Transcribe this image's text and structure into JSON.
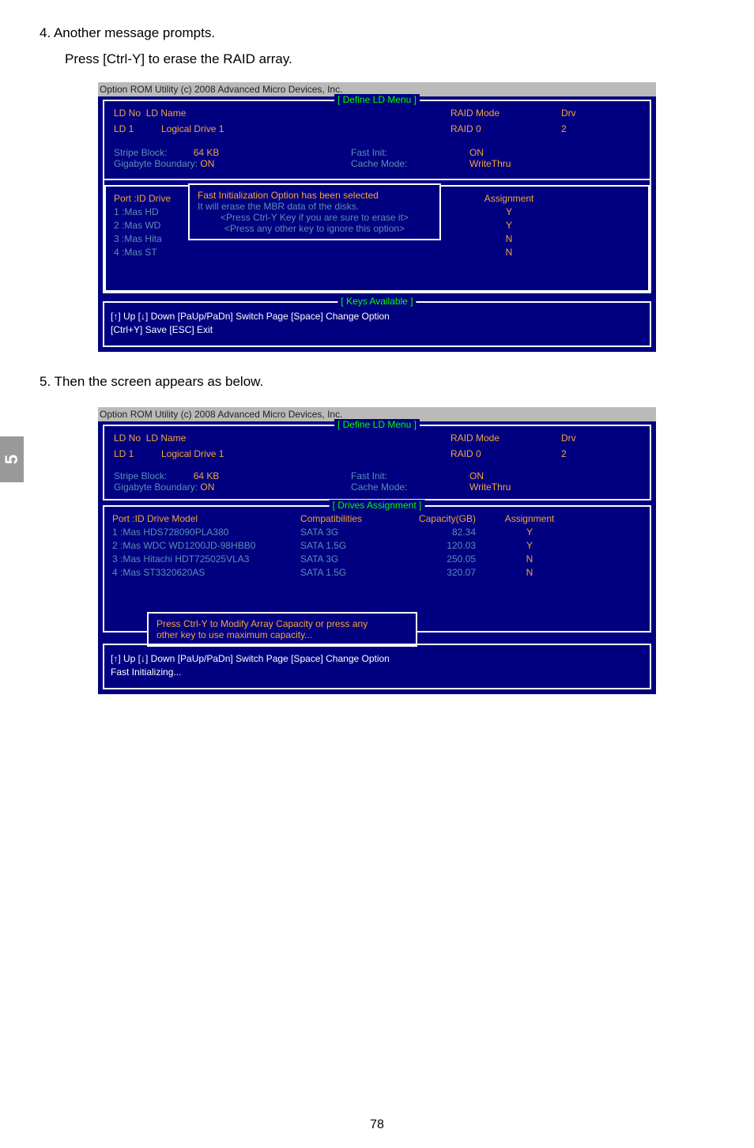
{
  "step4": {
    "line1": "4. Another message prompts.",
    "line2": "Press [Ctrl-Y] to erase the RAID array."
  },
  "step5": {
    "line1": "5. Then the screen appears as below."
  },
  "side_tab": "5",
  "bios1": {
    "title": "Option ROM Utility (c) 2008 Advanced Micro Devices, Inc.",
    "header": "[ Define LD Menu ]",
    "cols": {
      "ldno": "LD No",
      "ldname": "LD Name",
      "raidmode": "RAID Mode",
      "drv": "Drv"
    },
    "row": {
      "ldno": "LD  1",
      "ldname": "Logical Drive 1",
      "raidmode": "RAID 0",
      "drv": "2"
    },
    "stripe_label": "Stripe Block:",
    "stripe_val": "64   KB",
    "fast_label": "Fast Init:",
    "fast_val": "ON",
    "gig_label": "Gigabyte Boundary:",
    "gig_val": "ON",
    "cache_label": "Cache Mode:",
    "cache_val": "WriteThru",
    "drives_hdr": {
      "port": "Port :ID  Drive",
      "assign": "Assignment"
    },
    "drives": [
      {
        "id": "    1 :Mas HD",
        "a": "Y"
      },
      {
        "id": "    2 :Mas WD",
        "a": "Y"
      },
      {
        "id": "    3 :Mas Hita",
        "a": "N"
      },
      {
        "id": "    4 :Mas ST",
        "a": "N"
      }
    ],
    "popup": {
      "l1": "Fast Initialization Option has been selected",
      "l2": "It will erase the MBR data of the disks.",
      "l3": "<Press Ctrl-Y Key if you are sure to erase it>",
      "l4": "<Press any other key to ignore this option>"
    },
    "keys_header": "[ Keys Available ]",
    "keys_l1": "[↑] Up    [↓] Down    [PaUp/PaDn] Switch Page    [Space] Change Option",
    "keys_l2": "[Ctrl+Y] Save    [ESC] Exit"
  },
  "bios2": {
    "title": "Option ROM Utility (c) 2008 Advanced Micro Devices, Inc.",
    "header": "[ Define LD Menu ]",
    "cols": {
      "ldno": "LD No",
      "ldname": "LD Name",
      "raidmode": "RAID Mode",
      "drv": "Drv"
    },
    "row": {
      "ldno": "LD  1",
      "ldname": "Logical Drive 1",
      "raidmode": "RAID 0",
      "drv": "2"
    },
    "stripe_label": "Stripe Block:",
    "stripe_val": "64   KB",
    "fast_label": "Fast Init:",
    "fast_val": "ON",
    "gig_label": "Gigabyte Boundary:",
    "gig_val": "ON",
    "cache_label": "Cache Mode:",
    "cache_val": "WriteThru",
    "drives_header": "[ Drives Assignment ]",
    "drives_cols": {
      "port": "Port :ID  Drive Model",
      "comp": "Compatibilities",
      "cap": "Capacity(GB)",
      "assign": "Assignment"
    },
    "drives": [
      {
        "port": "    1 :Mas HDS728090PLA380",
        "comp": "SATA  3G",
        "cap": "82.34",
        "assign": "Y"
      },
      {
        "port": "    2 :Mas WDC WD1200JD-98HBB0",
        "comp": "SATA  1.5G",
        "cap": "120.03",
        "assign": "Y"
      },
      {
        "port": "    3 :Mas Hitachi HDT725025VLA3",
        "comp": "SATA  3G",
        "cap": "250.05",
        "assign": "N"
      },
      {
        "port": "    4 :Mas ST3320620AS",
        "comp": "SATA  1.5G",
        "cap": "320.07",
        "assign": "N"
      }
    ],
    "popup": {
      "l1": "Press Ctrl-Y to Modify Array Capacity or press any",
      "l2": "other key to use maximum capacity..."
    },
    "keys_l1": "[↑] Up    [↓] Down    [PaUp/PaDn] Switch Page    [Space] Change Option",
    "keys_l2": "Fast  Initializing..."
  },
  "pagenum": "78"
}
